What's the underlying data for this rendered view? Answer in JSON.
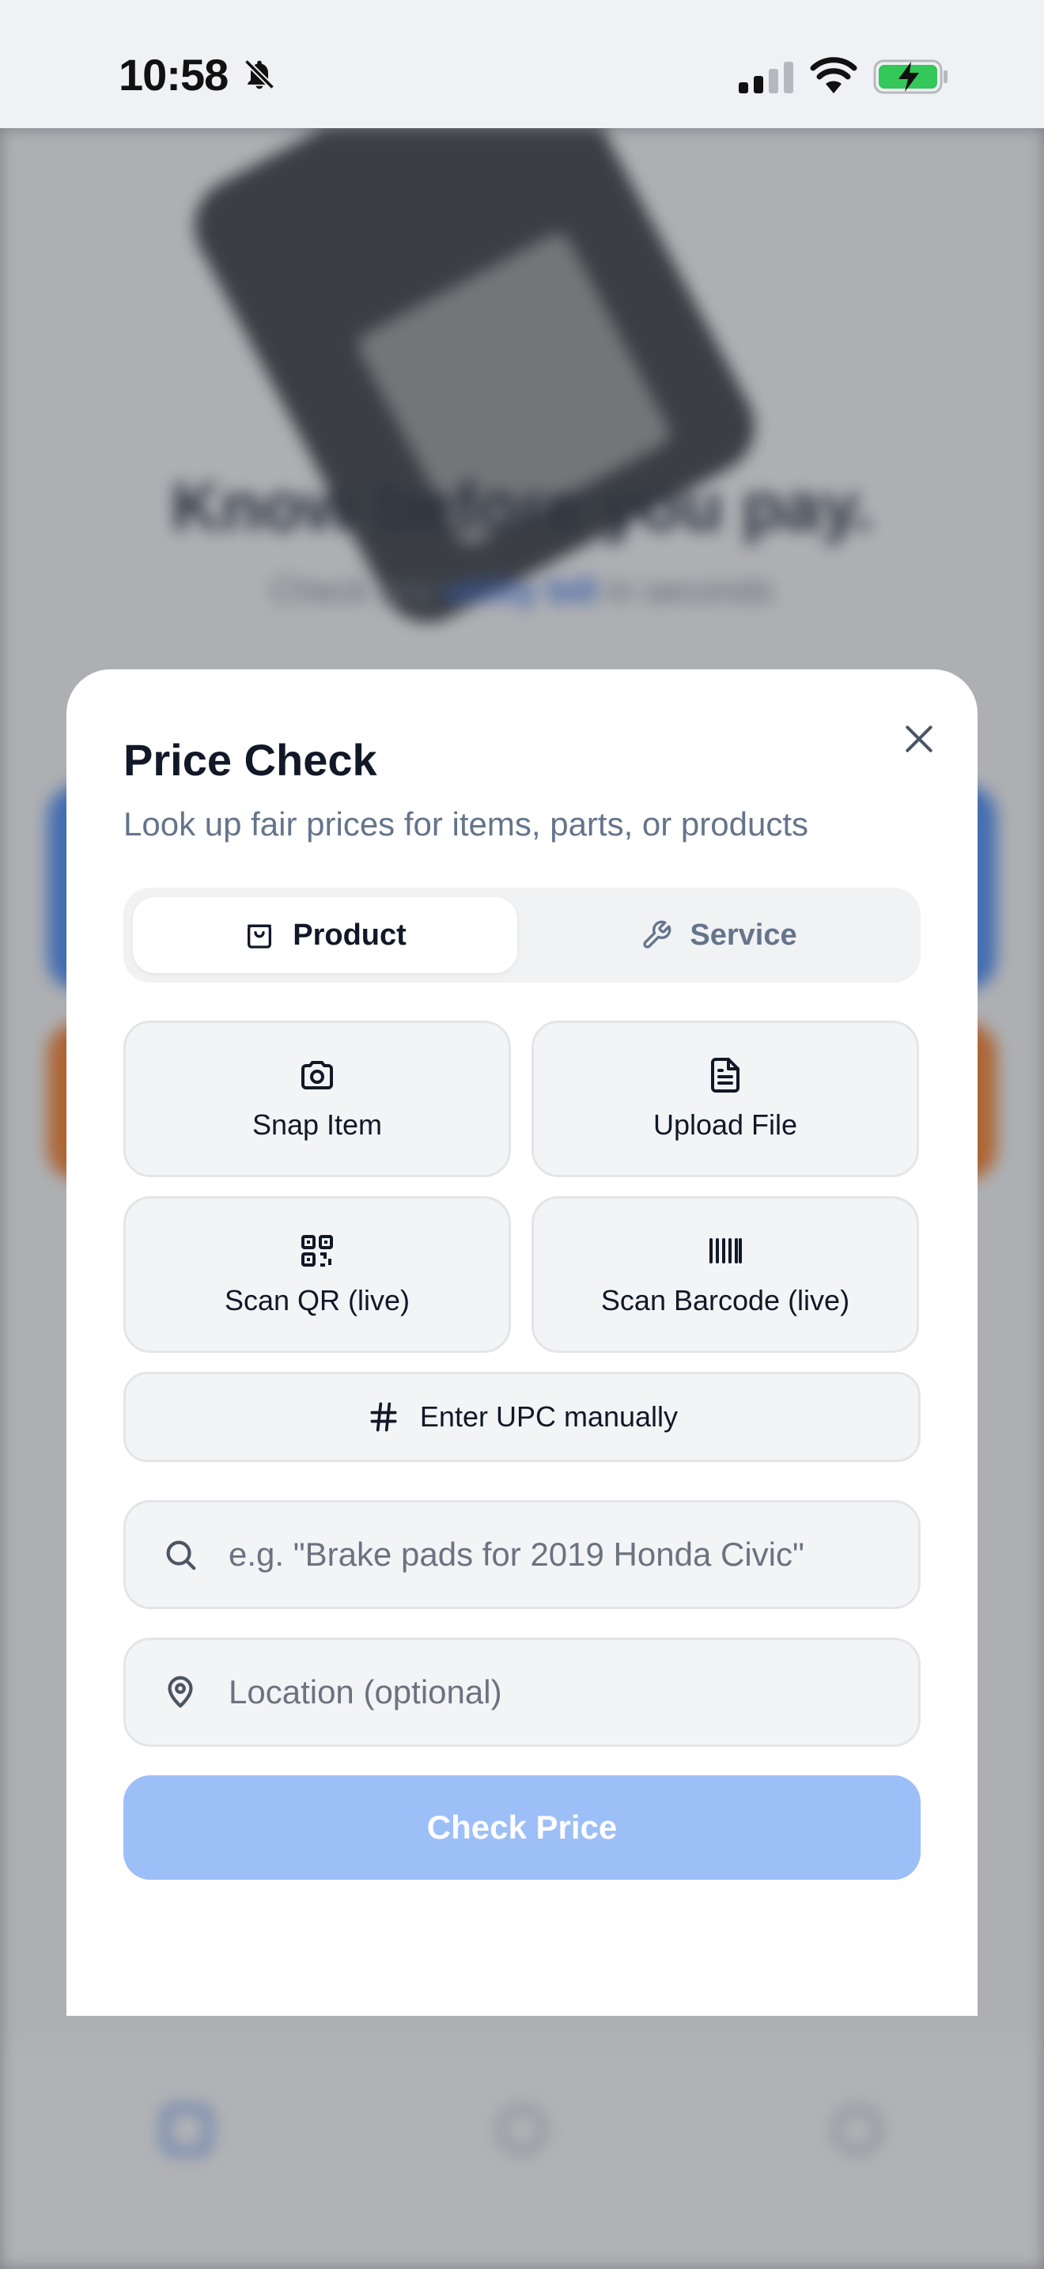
{
  "status_bar": {
    "time": "10:58",
    "icons": [
      "bell-slash-icon",
      "cellular-signal-icon",
      "wifi-icon",
      "battery-charging-icon"
    ],
    "battery_color": "#34c759"
  },
  "background": {
    "headline": "Know before you pay.",
    "subtitle_prefix": "Check any ",
    "subtitle_accent": "utility bill",
    "subtitle_suffix": " in seconds"
  },
  "modal": {
    "title": "Price Check",
    "subtitle": "Look up fair prices for items, parts, or products",
    "tabs": [
      {
        "label": "Product",
        "icon": "shopping-bag-icon",
        "active": true
      },
      {
        "label": "Service",
        "icon": "wrench-icon",
        "active": false
      }
    ],
    "actions": [
      {
        "label": "Snap Item",
        "icon": "camera-icon"
      },
      {
        "label": "Upload File",
        "icon": "file-text-icon"
      },
      {
        "label": "Scan QR (live)",
        "icon": "qr-code-icon"
      },
      {
        "label": "Scan Barcode (live)",
        "icon": "barcode-icon"
      }
    ],
    "upc_label": "Enter UPC manually",
    "search": {
      "value": "",
      "placeholder": "e.g. \"Brake pads for 2019 Honda Civic\""
    },
    "location": {
      "value": "",
      "placeholder": "Location (optional)"
    },
    "submit_label": "Check Price"
  },
  "colors": {
    "accent_disabled": "#9dbff7",
    "accent": "#2563eb"
  }
}
